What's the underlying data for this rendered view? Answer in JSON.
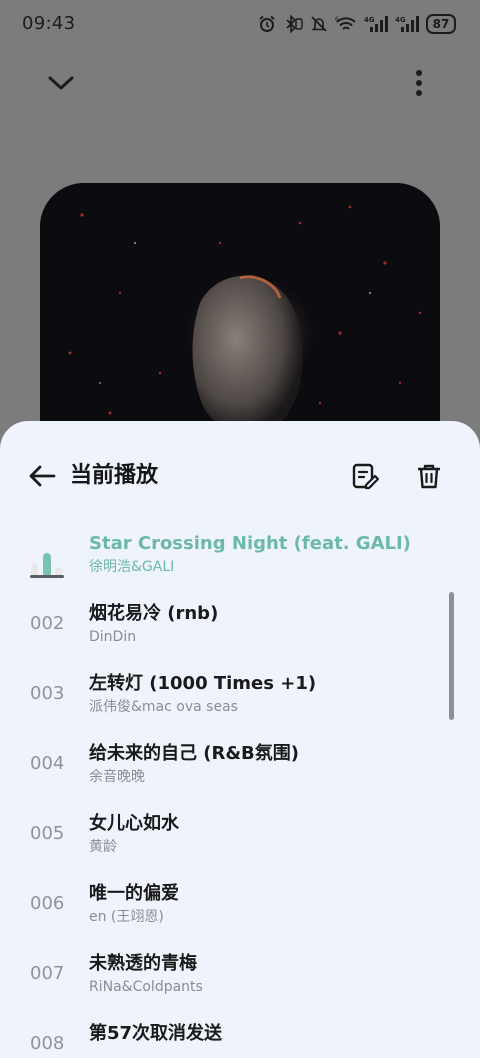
{
  "status_bar": {
    "time": "09:43",
    "battery": "87",
    "icons": [
      "alarm-icon",
      "bluetooth-icon",
      "silent-icon",
      "wifi-icon",
      "signal-4g-icon",
      "signal-4g-icon",
      "battery-icon"
    ]
  },
  "player": {
    "collapse_icon": "chevron-down-icon",
    "more_icon": "more-vertical-icon"
  },
  "sheet": {
    "title": "当前播放",
    "back_icon": "arrow-back-icon",
    "edit_icon": "edit-list-icon",
    "delete_icon": "trash-icon"
  },
  "queue": [
    {
      "num": "",
      "title": "Star Crossing Night (feat. GALI)",
      "artist": "徐明浩&GALI",
      "playing": true
    },
    {
      "num": "002",
      "title": "烟花易冷 (rnb)",
      "artist": "DinDin",
      "playing": false
    },
    {
      "num": "003",
      "title": "左转灯 (1000 Times +1)",
      "artist": "派伟俊&mac ova seas",
      "playing": false
    },
    {
      "num": "004",
      "title": "给未来的自己 (R&B氛围)",
      "artist": "余音晚晚",
      "playing": false
    },
    {
      "num": "005",
      "title": "女儿心如水",
      "artist": "黄龄",
      "playing": false
    },
    {
      "num": "006",
      "title": "唯一的偏爱",
      "artist": "en (王翊恩)",
      "playing": false
    },
    {
      "num": "007",
      "title": "未熟透的青梅",
      "artist": "RiNa&Coldpants",
      "playing": false
    },
    {
      "num": "008",
      "title": "第57次取消发送",
      "artist": "",
      "playing": false
    }
  ],
  "colors": {
    "accent": "#6cb9a8",
    "sheet_bg": "#eff4fc",
    "dim_bg": "#7c7c7c"
  }
}
